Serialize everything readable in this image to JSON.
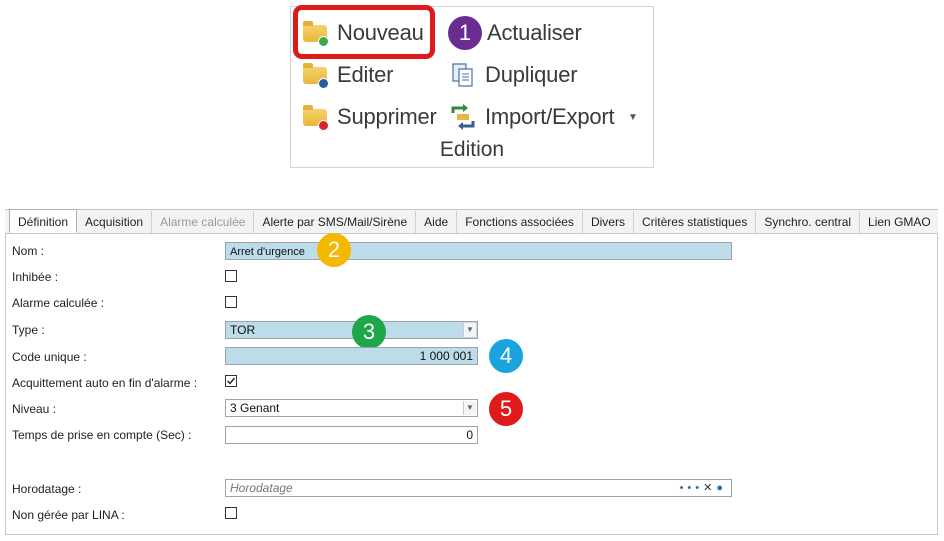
{
  "ribbon": {
    "nouveau": "Nouveau",
    "actualiser": "Actualiser",
    "editer": "Editer",
    "dupliquer": "Dupliquer",
    "supprimer": "Supprimer",
    "import_export": "Import/Export",
    "group_label": "Edition"
  },
  "markers": {
    "m1": "1",
    "m2": "2",
    "m3": "3",
    "m4": "4",
    "m5": "5"
  },
  "tabs": [
    "Définition",
    "Acquisition",
    "Alarme calculée",
    "Alerte par SMS/Mail/Sirène",
    "Aide",
    "Fonctions associées",
    "Divers",
    "Critères statistiques",
    "Synchro. central",
    "Lien GMAO"
  ],
  "form": {
    "nom_label": "Nom :",
    "nom_value": "Arret d'urgence",
    "inhibee_label": "Inhibée :",
    "inhibee_checked": false,
    "alarme_calculee_label": "Alarme calculée :",
    "alarme_calculee_checked": false,
    "type_label": "Type :",
    "type_value": "TOR",
    "code_unique_label": "Code unique :",
    "code_unique_value": "1 000 001",
    "acquittement_label": "Acquittement auto en fin d'alarme :",
    "acquittement_checked": true,
    "niveau_label": "Niveau :",
    "niveau_value": "3 Genant",
    "temps_label": "Temps de prise en compte (Sec) :",
    "temps_value": "0",
    "horodatage_label": "Horodatage :",
    "horodatage_placeholder": "Horodatage",
    "non_geree_label": "Non gérée par LINA :",
    "non_geree_checked": false
  },
  "colors": {
    "highlight": "#e0191b",
    "m1": "#6a2c91",
    "m2": "#f5b800",
    "m3": "#1fa54a",
    "m4": "#1ba3e0",
    "m5": "#e0191b",
    "field_blue": "#bcdcea"
  }
}
